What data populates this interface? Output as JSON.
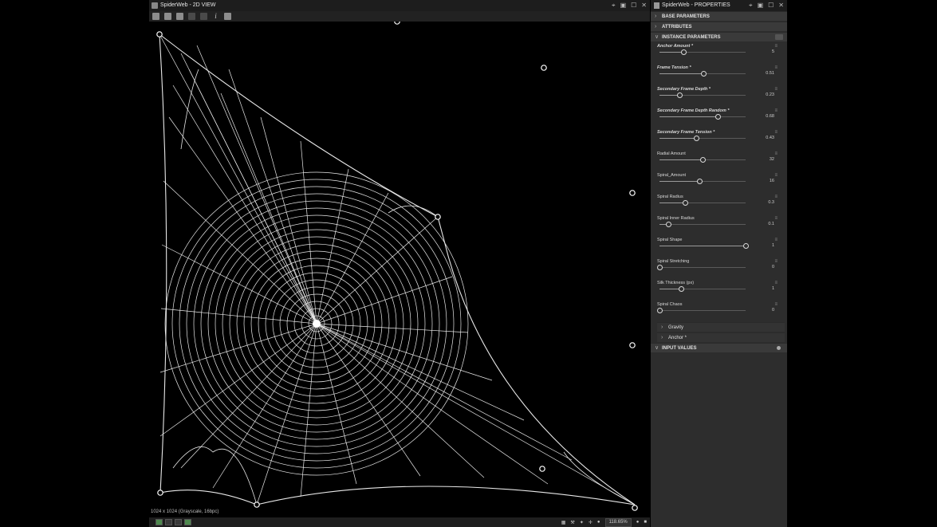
{
  "view2d": {
    "title": "SpiderWeb - 2D VIEW",
    "image_info": "1024 x 1024 (Grayscale, 16bpc)",
    "zoom": "118.65%"
  },
  "properties": {
    "title": "SpiderWeb - PROPERTIES",
    "sections": {
      "base": "BASE PARAMETERS",
      "attributes": "ATTRIBUTES",
      "instance": "INSTANCE PARAMETERS",
      "gravity": "Gravity",
      "anchor": "Anchor *",
      "input": "INPUT VALUES"
    },
    "params": [
      {
        "label": "Anchor Amount *",
        "value": "5",
        "fraction": 0.28,
        "bold": true
      },
      {
        "label": "Frame Tension *",
        "value": "0.51",
        "fraction": 0.51,
        "bold": true
      },
      {
        "label": "Secondary Frame Depth *",
        "value": "0.23",
        "fraction": 0.23,
        "bold": true
      },
      {
        "label": "Secondary Frame Depth Random *",
        "value": "0.68",
        "fraction": 0.68,
        "bold": true
      },
      {
        "label": "Secondary Frame Tension *",
        "value": "0.43",
        "fraction": 0.43,
        "bold": true
      },
      {
        "label": "Radial Amount",
        "value": "32",
        "fraction": 0.5,
        "bold": false
      },
      {
        "label": "Spiral_Amount",
        "value": "16",
        "fraction": 0.46,
        "bold": false
      },
      {
        "label": "Spiral Radius",
        "value": "0.3",
        "fraction": 0.3,
        "bold": false
      },
      {
        "label": "Spiral Inner Radius",
        "value": "0.1",
        "fraction": 0.1,
        "bold": false
      },
      {
        "label": "Spiral Shape",
        "value": "1",
        "fraction": 1.0,
        "bold": false
      },
      {
        "label": "Spiral Stretching",
        "value": "0",
        "fraction": 0.0,
        "bold": false
      },
      {
        "label": "Silk Thickness (px)",
        "value": "1",
        "fraction": 0.25,
        "bold": false
      },
      {
        "label": "Spiral Chaos",
        "value": "0",
        "fraction": 0.0,
        "bold": false
      }
    ]
  }
}
